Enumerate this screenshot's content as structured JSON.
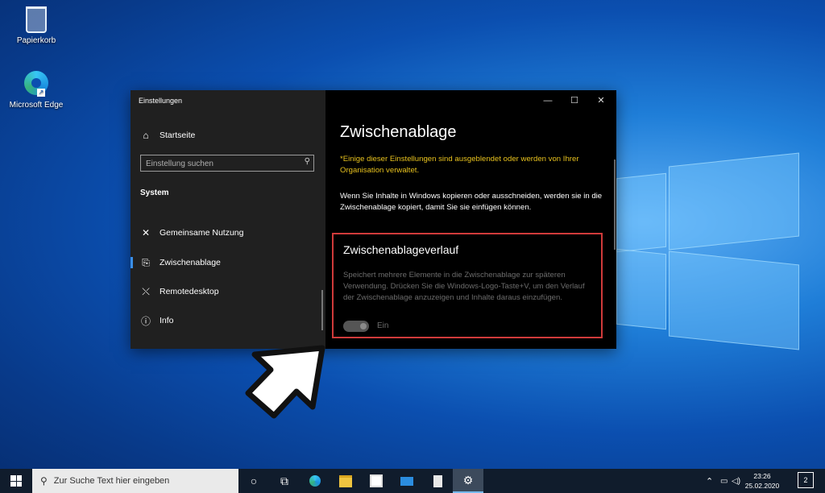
{
  "desktop": {
    "icons": [
      {
        "label": "Papierkorb"
      },
      {
        "label": "Microsoft Edge"
      }
    ]
  },
  "window": {
    "title": "Einstellungen",
    "caption_buttons": {
      "minimize": "—",
      "maximize": "☐",
      "close": "✕"
    }
  },
  "sidebar": {
    "home": {
      "label": "Startseite",
      "icon": "home-icon"
    },
    "search": {
      "placeholder": "Einstellung suchen",
      "icon": "search-icon"
    },
    "section": "System",
    "items": [
      {
        "label": "Gemeinsame Nutzung",
        "icon": "share-icon"
      },
      {
        "label": "Zwischenablage",
        "icon": "clipboard-icon",
        "selected": true
      },
      {
        "label": "Remotedesktop",
        "icon": "remote-desktop-icon"
      },
      {
        "label": "Info",
        "icon": "info-icon"
      }
    ]
  },
  "main": {
    "title": "Zwischenablage",
    "policy_notice": "*Einige dieser Einstellungen sind ausgeblendet oder werden von Ihrer Organisation verwaltet.",
    "description": "Wenn Sie Inhalte in Windows kopieren oder ausschneiden, werden sie in die Zwischenablage kopiert, damit Sie sie einfügen können.",
    "history": {
      "title": "Zwischenablageverlauf",
      "description": "Speichert mehrere Elemente in die Zwischenablage zur späteren Verwendung. Drücken Sie die Windows-Logo-Taste+V, um den Verlauf der Zwischenablage anzuzeigen und Inhalte daraus einzufügen.",
      "toggle_label": "Ein",
      "toggle_state": "on-disabled"
    },
    "highlight_color": "#d03a3a",
    "notice_color": "#e8c21e"
  },
  "taskbar": {
    "search_placeholder": "Zur Suche Text hier eingeben",
    "apps": [
      "cortana-icon",
      "task-view-icon",
      "edge-icon",
      "file-explorer-icon",
      "store-icon",
      "mail-icon",
      "notepad-icon",
      "settings-icon"
    ],
    "clock": {
      "time": "23:26",
      "date": "25.02.2020"
    },
    "notifications": "2"
  }
}
